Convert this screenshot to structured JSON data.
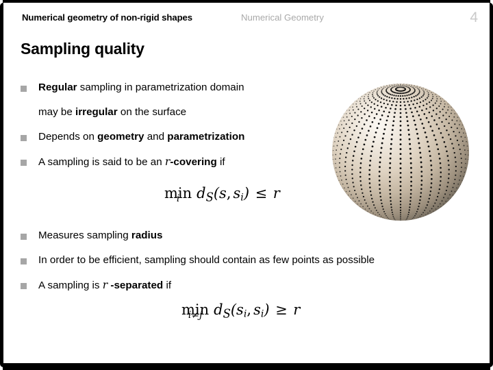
{
  "header": {
    "title": "Numerical geometry of non-rigid shapes",
    "subtitle": "Numerical Geometry",
    "page_number": "4",
    "title_color": "#000000",
    "subtitle_color": "#a9a9a9",
    "page_number_color": "#c9c9c9"
  },
  "slide": {
    "title": "Sampling quality",
    "background_color": "#ffffff",
    "border_color": "#000000",
    "bullet_marker_color": "#a6a6a6"
  },
  "bullets": [
    {
      "id": "bullet-regular-sampling",
      "marker": true,
      "segments": [
        {
          "text": "Regular",
          "bold": true
        },
        {
          "text": " sampling in parametrization domain",
          "bold": false
        }
      ]
    },
    {
      "id": "bullet-regular-sampling-cont",
      "marker": false,
      "segments": [
        {
          "text": "may be ",
          "bold": false
        },
        {
          "text": "irregular",
          "bold": true
        },
        {
          "text": " on the surface",
          "bold": false
        }
      ]
    },
    {
      "id": "bullet-depends-on",
      "marker": true,
      "segments": [
        {
          "text": "Depends on ",
          "bold": false
        },
        {
          "text": "geometry",
          "bold": true
        },
        {
          "text": " and ",
          "bold": false
        },
        {
          "text": "parametrization",
          "bold": true
        }
      ]
    },
    {
      "id": "bullet-r-covering",
      "marker": true,
      "segments": [
        {
          "text": "A sampling is said to be an ",
          "bold": false
        },
        {
          "text": "r",
          "bold": false,
          "math": true
        },
        {
          "text": "-covering",
          "bold": true
        },
        {
          "text": " if",
          "bold": false
        }
      ]
    },
    {
      "id": "bullet-measures-radius",
      "marker": true,
      "segments": [
        {
          "text": "Measures sampling ",
          "bold": false
        },
        {
          "text": "radius",
          "bold": true
        }
      ]
    },
    {
      "id": "bullet-efficient",
      "marker": true,
      "segments": [
        {
          "text": "In order to be efficient, sampling should contain as few points as possible",
          "bold": false
        }
      ]
    },
    {
      "id": "bullet-r-separated",
      "marker": true,
      "segments": [
        {
          "text": "A sampling is ",
          "bold": false
        },
        {
          "text": "r",
          "bold": false,
          "math": true
        },
        {
          "text": " -separated",
          "bold": true
        },
        {
          "text": " if",
          "bold": false
        }
      ]
    }
  ],
  "formulas": {
    "covering": {
      "operator": "min",
      "limit": "i",
      "distance": "d",
      "distance_subscript": "S",
      "open_paren": "(",
      "arg1": "s",
      "comma": ",",
      "arg2": "s",
      "arg2_subscript": "i",
      "close_paren": ")",
      "relation": "≤",
      "rhs": "r",
      "plain_text": "min_i d_S(s, s_i) ≤ r"
    },
    "separated": {
      "operator": "min",
      "limit": "i≠j",
      "distance": "d",
      "distance_subscript": "S",
      "open_paren": "(",
      "arg1": "s",
      "arg1_subscript": "i",
      "comma": ",",
      "arg2": "s",
      "arg2_subscript": "i",
      "close_paren": ")",
      "relation": "≥",
      "rhs": "r",
      "plain_text": "min_{i≠j} d_S(s_i, s_i) ≥ r"
    }
  },
  "figure": {
    "name": "sampled-sphere",
    "description": "Shaded 3D sphere covered with a regular latitude-longitude grid of black sample points, dense near the top pole and sparse near the equator",
    "highlight_color": "#f5f1ea",
    "midtone_color": "#cbbfae",
    "shadow_color": "#4b4840",
    "point_color": "#101010"
  }
}
